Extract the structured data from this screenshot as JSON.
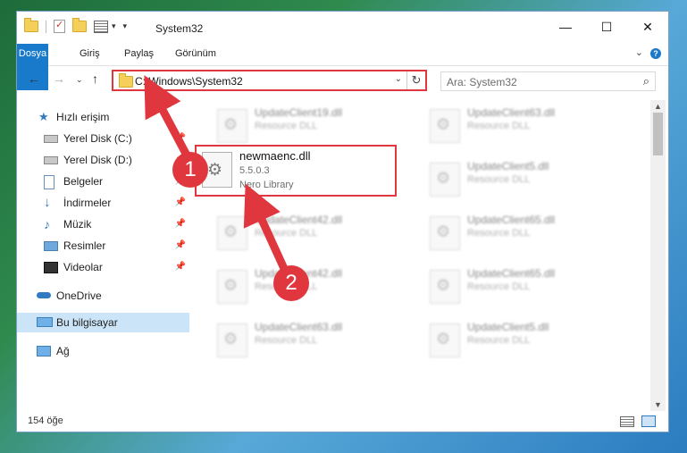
{
  "window": {
    "title": "System32",
    "controls": {
      "minimize": "—",
      "maximize": "☐",
      "close": "✕"
    }
  },
  "ribbon": {
    "tabs": [
      "Dosya",
      "Giriş",
      "Paylaş",
      "Görünüm"
    ],
    "help": "?"
  },
  "nav": {
    "address": "C:\\Windows\\System32",
    "search_placeholder": "Ara: System32"
  },
  "sidebar": {
    "items": [
      {
        "label": "Hızlı erişim",
        "icon": "star-icon",
        "pinned": false
      },
      {
        "label": "Yerel Disk (C:)",
        "icon": "drive-icon",
        "pinned": true
      },
      {
        "label": "Yerel Disk (D:)",
        "icon": "drive-icon",
        "pinned": true
      },
      {
        "label": "Belgeler",
        "icon": "documents-icon",
        "pinned": true
      },
      {
        "label": "İndirmeler",
        "icon": "download-icon",
        "pinned": true
      },
      {
        "label": "Müzik",
        "icon": "music-icon",
        "pinned": true
      },
      {
        "label": "Resimler",
        "icon": "pictures-icon",
        "pinned": true
      },
      {
        "label": "Videolar",
        "icon": "videos-icon",
        "pinned": true
      },
      {
        "label": "OneDrive",
        "icon": "cloud-icon",
        "pinned": false
      },
      {
        "label": "Bu bilgisayar",
        "icon": "computer-icon",
        "pinned": false,
        "selected": true
      },
      {
        "label": "Ağ",
        "icon": "network-icon",
        "pinned": false
      }
    ]
  },
  "files": {
    "left": [
      {
        "name": "UpdateClient19.dll",
        "type": "Resource DLL"
      },
      {
        "name": "UpdateClient42.dll",
        "type": "Resource DLL"
      },
      {
        "name": "UpdateClient42.dll",
        "type": "Resource DLL"
      },
      {
        "name": "UpdateClient63.dll",
        "type": "Resource DLL"
      }
    ],
    "right": [
      {
        "name": "UpdateClient63.dll",
        "type": "Resource DLL"
      },
      {
        "name": "UpdateClient5.dll",
        "type": "Resource DLL"
      },
      {
        "name": "UpdateClient65.dll",
        "type": "Resource DLL"
      },
      {
        "name": "UpdateClient65.dll",
        "type": "Resource DLL"
      },
      {
        "name": "UpdateClient5.dll",
        "type": "Resource DLL"
      }
    ],
    "highlighted": {
      "name": "newmaenc.dll",
      "version": "5.5.0.3",
      "description": "Nero Library"
    }
  },
  "status": {
    "count": "154 öğe"
  },
  "annotations": {
    "badge1": "1",
    "badge2": "2",
    "accent": "#e0373e"
  }
}
